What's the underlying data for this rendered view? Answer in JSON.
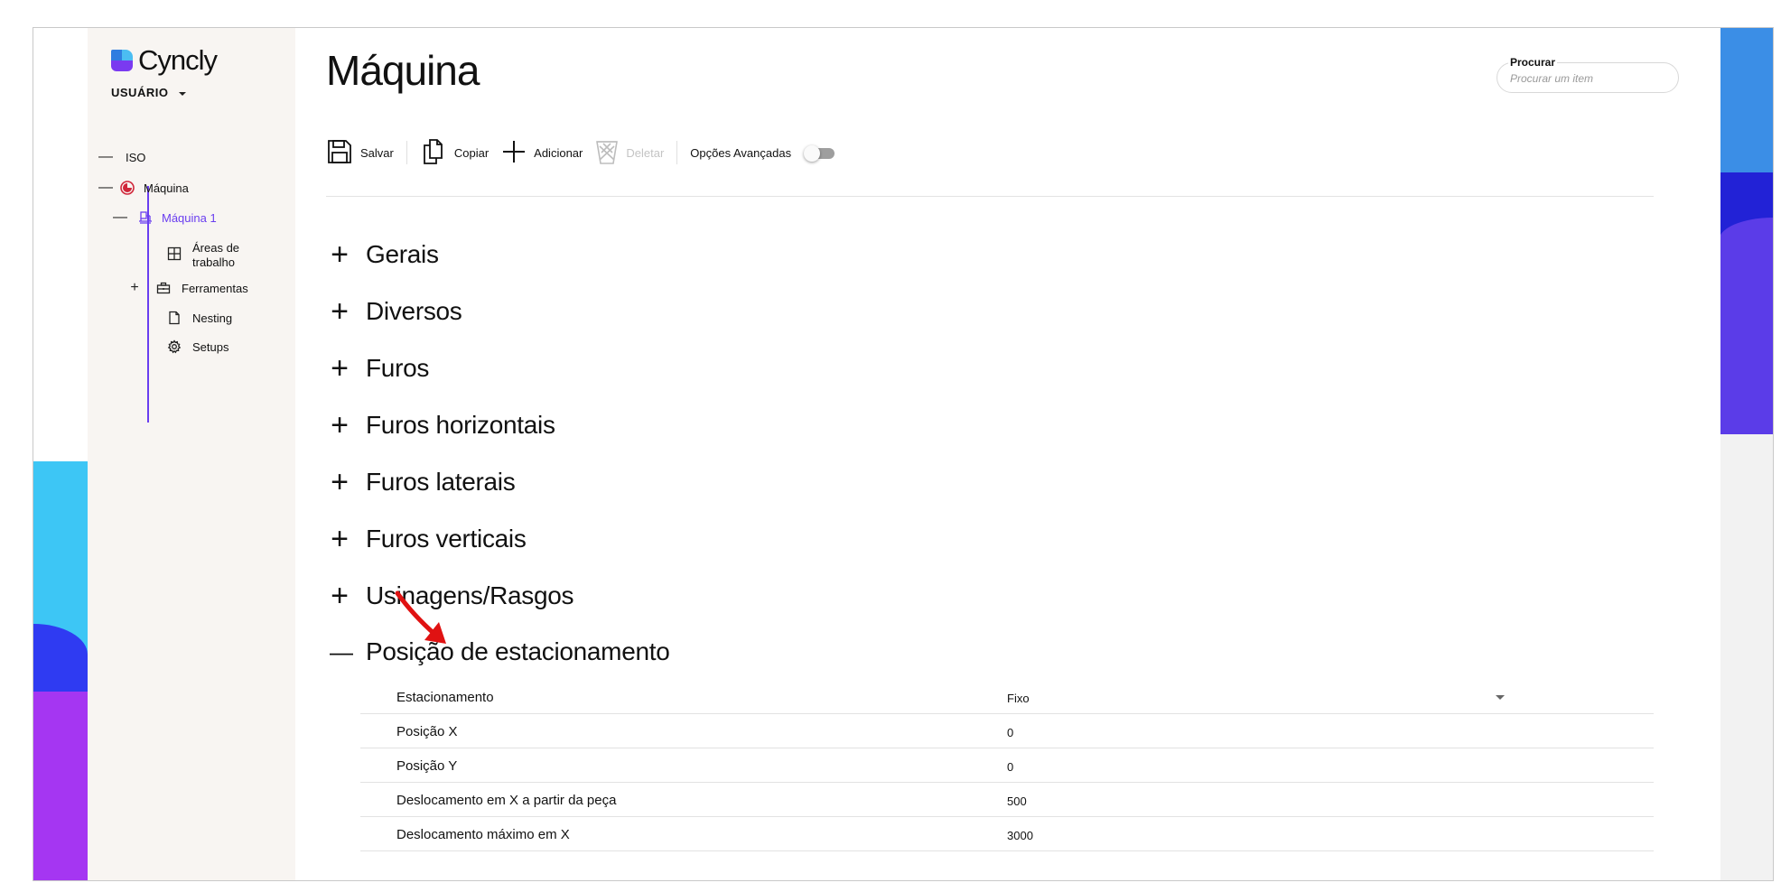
{
  "app": {
    "logo_text": "Cyncly",
    "user_menu_label": "USUÁRIO"
  },
  "sidebar": {
    "items": [
      {
        "label": "ISO",
        "toggle": "—",
        "icon": "none"
      },
      {
        "label": "Máquina",
        "toggle": "—",
        "icon": "machine-logo-icon"
      },
      {
        "label": "Máquina 1",
        "toggle": "—",
        "icon": "machine-icon"
      },
      {
        "label": "Áreas de trabalho",
        "toggle": "",
        "icon": "grid-icon"
      },
      {
        "label": "Ferramentas",
        "toggle": "+",
        "icon": "toolbox-icon"
      },
      {
        "label": "Nesting",
        "toggle": "",
        "icon": "document-icon"
      },
      {
        "label": "Setups",
        "toggle": "",
        "icon": "gear-icon"
      }
    ],
    "active_color": "#6a3ef0",
    "machine_logo_color": "#d0263a"
  },
  "main": {
    "title": "Máquina"
  },
  "search": {
    "label": "Procurar",
    "placeholder": "Procurar um item"
  },
  "toolbar": {
    "save": "Salvar",
    "copy": "Copiar",
    "add": "Adicionar",
    "delete": "Deletar",
    "advanced": "Opções Avançadas"
  },
  "sections": [
    {
      "label": "Gerais",
      "sign": "+"
    },
    {
      "label": "Diversos",
      "sign": "+"
    },
    {
      "label": "Furos",
      "sign": "+"
    },
    {
      "label": "Furos horizontais",
      "sign": "+"
    },
    {
      "label": "Furos laterais",
      "sign": "+"
    },
    {
      "label": "Furos verticais",
      "sign": "+"
    },
    {
      "label": "Usinagens/Rasgos",
      "sign": "+"
    },
    {
      "label": "Posição de estacionamento",
      "sign": "—"
    }
  ],
  "properties": [
    {
      "name": "Estacionamento",
      "value": "Fixo",
      "type": "select"
    },
    {
      "name": "Posição X",
      "value": "0"
    },
    {
      "name": "Posição Y",
      "value": "0"
    },
    {
      "name": "Deslocamento em X a partir da peça",
      "value": "500"
    },
    {
      "name": "Deslocamento máximo em X",
      "value": "3000"
    }
  ]
}
